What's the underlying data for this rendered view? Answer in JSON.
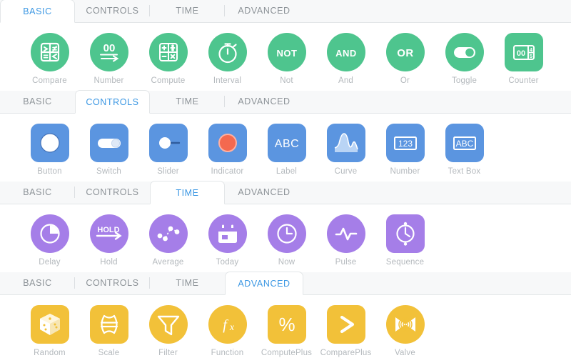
{
  "theme": {
    "green": "#4ec58e",
    "blue": "#5b95e0",
    "purple": "#a57ee8",
    "yellow": "#f2c139",
    "indicator_orange": "#f4694f",
    "active_tab_text": "#3b97e3",
    "inactive_tab_text": "#8d9398",
    "label_text": "#b4b9bd",
    "tabbar_bg": "#f7f8f9",
    "panel_bg": "#ffffff"
  },
  "tabs": [
    "BASIC",
    "CONTROLS",
    "TIME",
    "ADVANCED"
  ],
  "sections": [
    {
      "active_tab": "BASIC",
      "active_index": 0,
      "color": "#4ec58e",
      "items": [
        {
          "label": "Compare",
          "icon": "compare-icon",
          "shape": "circle"
        },
        {
          "label": "Number",
          "icon": "number-icon",
          "shape": "circle",
          "text": "00"
        },
        {
          "label": "Compute",
          "icon": "compute-icon",
          "shape": "circle"
        },
        {
          "label": "Interval",
          "icon": "stopwatch-icon",
          "shape": "circle"
        },
        {
          "label": "Not",
          "icon": "not-icon",
          "shape": "circle",
          "text": "NOT"
        },
        {
          "label": "And",
          "icon": "and-icon",
          "shape": "circle",
          "text": "AND"
        },
        {
          "label": "Or",
          "icon": "or-icon",
          "shape": "circle",
          "text": "OR"
        },
        {
          "label": "Toggle",
          "icon": "toggle-icon",
          "shape": "circle"
        },
        {
          "label": "Counter",
          "icon": "counter-icon",
          "shape": "square",
          "text": "00"
        }
      ]
    },
    {
      "active_tab": "CONTROLS",
      "active_index": 1,
      "color": "#5b95e0",
      "items": [
        {
          "label": "Button",
          "icon": "button-icon",
          "shape": "square"
        },
        {
          "label": "Switch",
          "icon": "switch-icon",
          "shape": "square"
        },
        {
          "label": "Slider",
          "icon": "slider-icon",
          "shape": "square"
        },
        {
          "label": "Indicator",
          "icon": "indicator-icon",
          "shape": "square"
        },
        {
          "label": "Label",
          "icon": "label-icon",
          "shape": "square",
          "text": "ABC"
        },
        {
          "label": "Curve",
          "icon": "curve-icon",
          "shape": "square"
        },
        {
          "label": "Number",
          "icon": "number-box-icon",
          "shape": "square",
          "text": "123"
        },
        {
          "label": "Text Box",
          "icon": "text-box-icon",
          "shape": "square",
          "text": "ABC"
        }
      ]
    },
    {
      "active_tab": "TIME",
      "active_index": 2,
      "color": "#a57ee8",
      "items": [
        {
          "label": "Delay",
          "icon": "pie-timer-icon",
          "shape": "circle"
        },
        {
          "label": "Hold",
          "icon": "hold-icon",
          "shape": "circle",
          "text": "HOLD"
        },
        {
          "label": "Average",
          "icon": "average-icon",
          "shape": "circle"
        },
        {
          "label": "Today",
          "icon": "calendar-icon",
          "shape": "circle"
        },
        {
          "label": "Now",
          "icon": "clock-icon",
          "shape": "circle"
        },
        {
          "label": "Pulse",
          "icon": "pulse-icon",
          "shape": "circle"
        },
        {
          "label": "Sequence",
          "icon": "sequence-icon",
          "shape": "square"
        }
      ]
    },
    {
      "active_tab": "ADVANCED",
      "active_index": 3,
      "color": "#f2c139",
      "items": [
        {
          "label": "Random",
          "icon": "dice-icon",
          "shape": "square"
        },
        {
          "label": "Scale",
          "icon": "scale-icon",
          "shape": "square"
        },
        {
          "label": "Filter",
          "icon": "funnel-icon",
          "shape": "circle"
        },
        {
          "label": "Function",
          "icon": "function-icon",
          "shape": "circle",
          "text": "fx"
        },
        {
          "label": "ComputePlus",
          "icon": "percent-icon",
          "shape": "square",
          "text": "%"
        },
        {
          "label": "ComparePlus",
          "icon": "greater-than-icon",
          "shape": "square",
          "text": ">"
        },
        {
          "label": "Valve",
          "icon": "valve-icon",
          "shape": "circle"
        }
      ]
    }
  ]
}
